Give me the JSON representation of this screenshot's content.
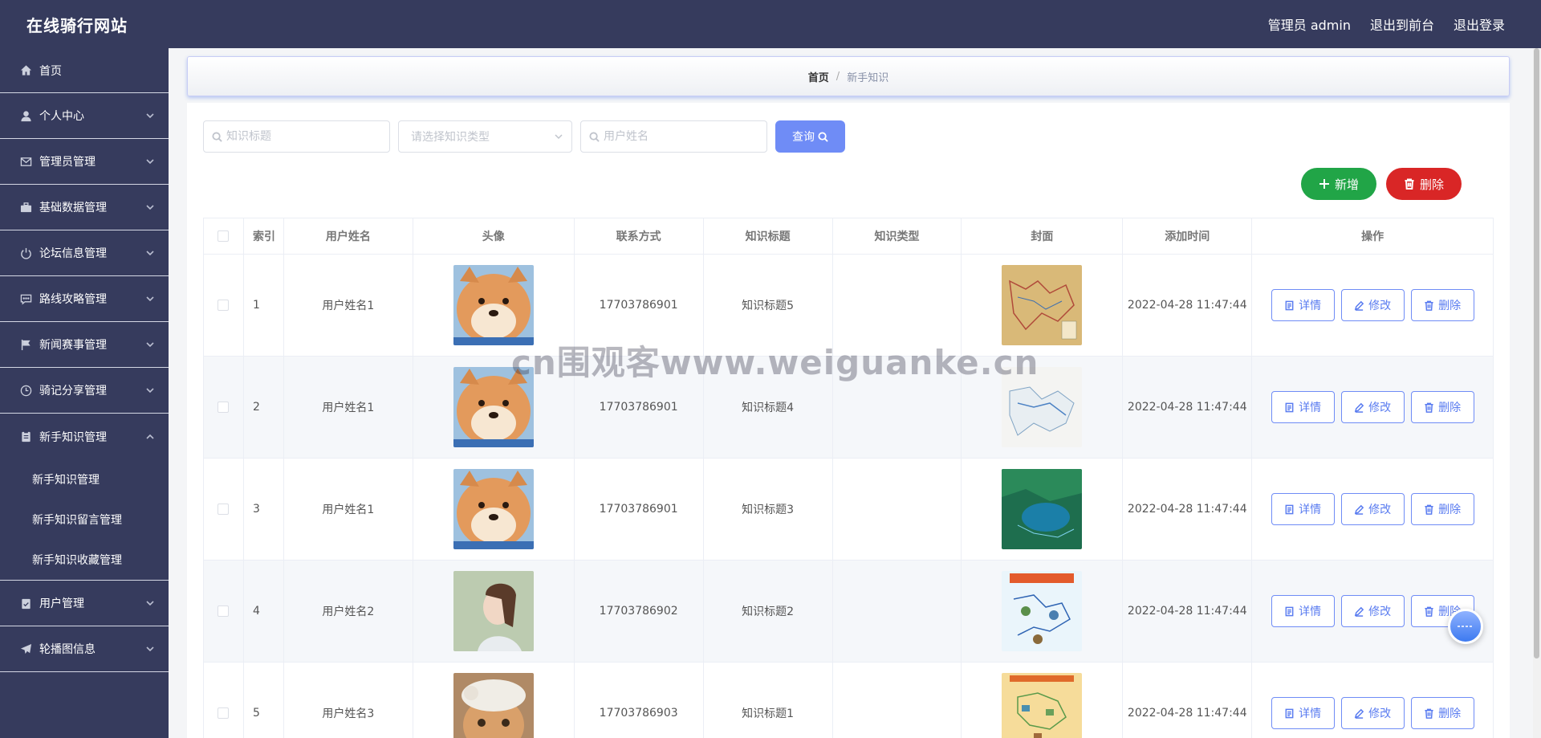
{
  "header": {
    "title": "在线骑行网站",
    "links": [
      "管理员 admin",
      "退出到前台",
      "退出登录"
    ]
  },
  "sidebar": {
    "items": [
      {
        "label": "首页",
        "icon": "home-icon"
      },
      {
        "label": "个人中心",
        "icon": "user-icon"
      },
      {
        "label": "管理员管理",
        "icon": "mail-icon"
      },
      {
        "label": "基础数据管理",
        "icon": "briefcase-icon"
      },
      {
        "label": "论坛信息管理",
        "icon": "power-icon"
      },
      {
        "label": "路线攻略管理",
        "icon": "chat-icon"
      },
      {
        "label": "新闻赛事管理",
        "icon": "flag-icon"
      },
      {
        "label": "骑记分享管理",
        "icon": "clock-icon"
      },
      {
        "label": "新手知识管理",
        "icon": "clipboard-icon"
      },
      {
        "label": "用户管理",
        "icon": "check-list-icon"
      },
      {
        "label": "轮播图信息",
        "icon": "send-icon"
      }
    ],
    "subitems": [
      "新手知识管理",
      "新手知识留言管理",
      "新手知识收藏管理"
    ]
  },
  "breadcrumb": {
    "home": "首页",
    "separator": "/",
    "current": "新手知识"
  },
  "search": {
    "title_placeholder": "知识标题",
    "type_placeholder": "请选择知识类型",
    "user_placeholder": "用户姓名",
    "query_label": "查询"
  },
  "actions": {
    "add_label": "新增",
    "delete_label": "删除"
  },
  "table": {
    "headers": [
      "索引",
      "用户姓名",
      "头像",
      "联系方式",
      "知识标题",
      "知识类型",
      "封面",
      "添加时间",
      "操作"
    ],
    "ops": {
      "detail": "详情",
      "edit": "修改",
      "delete": "删除"
    },
    "rows": [
      {
        "index": "1",
        "name": "用户姓名1",
        "phone": "17703786901",
        "title": "知识标题5",
        "type": "",
        "time": "2022-04-28 11:47:44"
      },
      {
        "index": "2",
        "name": "用户姓名1",
        "phone": "17703786901",
        "title": "知识标题4",
        "type": "",
        "time": "2022-04-28 11:47:44"
      },
      {
        "index": "3",
        "name": "用户姓名1",
        "phone": "17703786901",
        "title": "知识标题3",
        "type": "",
        "time": "2022-04-28 11:47:44"
      },
      {
        "index": "4",
        "name": "用户姓名2",
        "phone": "17703786902",
        "title": "知识标题2",
        "type": "",
        "time": "2022-04-28 11:47:44"
      },
      {
        "index": "5",
        "name": "用户姓名3",
        "phone": "17703786903",
        "title": "知识标题1",
        "type": "",
        "time": "2022-04-28 11:47:44"
      }
    ]
  },
  "watermark": "cn围观客www.weiguanke.cn"
}
